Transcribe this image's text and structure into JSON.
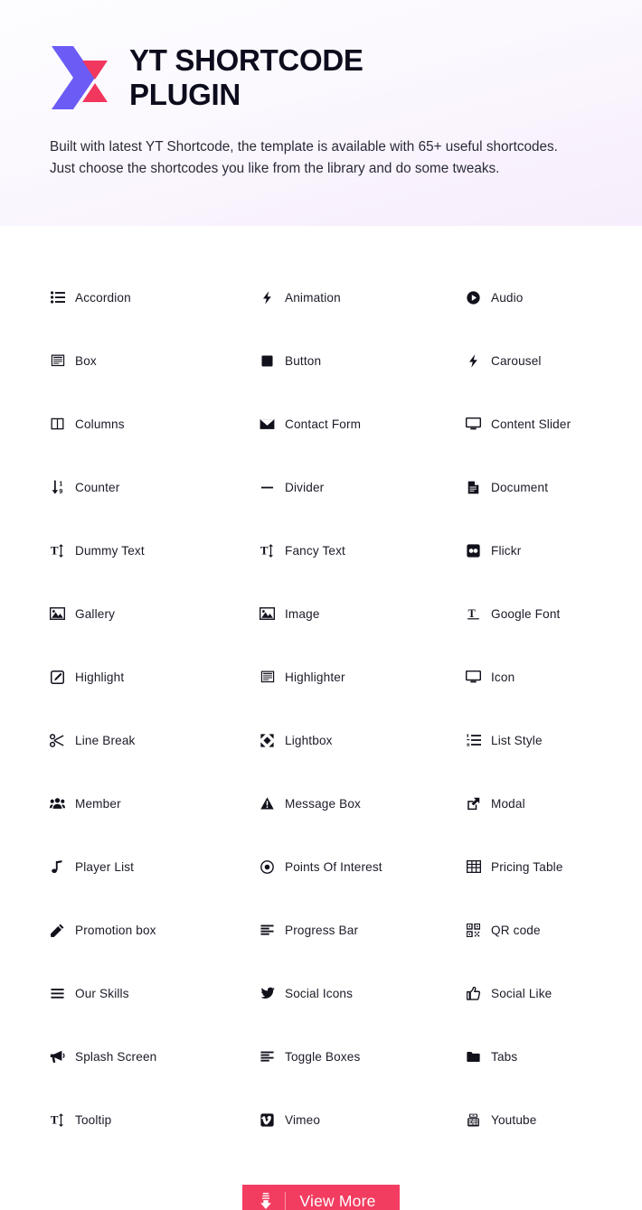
{
  "hero": {
    "logo_icon": "yt-shortcode-logo",
    "logo_colors": {
      "chevron": "#6b5cf6",
      "accent": "#f2375f"
    },
    "title": "YT SHORTCODE PLUGIN",
    "description": "Built with latest YT Shortcode, the template is available with 65+ useful shortcodes. Just choose the shortcodes you like from the library and do some tweaks.",
    "background_from": "#fdfdff",
    "background_to": "#f7edfc"
  },
  "shortcodes": [
    {
      "label": "Accordion",
      "icon": "list-ul-icon"
    },
    {
      "label": "Animation",
      "icon": "bolt-icon"
    },
    {
      "label": "Audio",
      "icon": "play-circle-icon"
    },
    {
      "label": "Box",
      "icon": "window-text-icon"
    },
    {
      "label": "Button",
      "icon": "square-filled-icon"
    },
    {
      "label": "Carousel",
      "icon": "bolt-icon"
    },
    {
      "label": "Columns",
      "icon": "columns-icon"
    },
    {
      "label": "Contact Form",
      "icon": "envelope-icon"
    },
    {
      "label": "Content Slider",
      "icon": "desktop-icon"
    },
    {
      "label": "Counter",
      "icon": "sort-numeric-down-icon"
    },
    {
      "label": "Divider",
      "icon": "minus-icon"
    },
    {
      "label": "Document",
      "icon": "file-lines-icon"
    },
    {
      "label": "Dummy Text",
      "icon": "text-height-icon"
    },
    {
      "label": "Fancy Text",
      "icon": "text-height-icon"
    },
    {
      "label": "Flickr",
      "icon": "flickr-icon"
    },
    {
      "label": "Gallery",
      "icon": "image-icon"
    },
    {
      "label": "Image",
      "icon": "image-icon"
    },
    {
      "label": "Google Font",
      "icon": "text-width-icon"
    },
    {
      "label": "Highlight",
      "icon": "pen-square-icon"
    },
    {
      "label": "Highlighter",
      "icon": "window-text-icon"
    },
    {
      "label": "Icon",
      "icon": "desktop-icon"
    },
    {
      "label": "Line Break",
      "icon": "scissors-icon"
    },
    {
      "label": "Lightbox",
      "icon": "expand-arrows-icon"
    },
    {
      "label": "List Style",
      "icon": "list-ol-icon"
    },
    {
      "label": "Member",
      "icon": "users-icon"
    },
    {
      "label": "Message Box",
      "icon": "exclamation-triangle-icon"
    },
    {
      "label": "Modal",
      "icon": "external-link-icon"
    },
    {
      "label": "Player List",
      "icon": "music-note-icon"
    },
    {
      "label": "Points Of Interest",
      "icon": "dot-circle-icon"
    },
    {
      "label": "Pricing Table",
      "icon": "table-icon"
    },
    {
      "label": "Promotion box",
      "icon": "pencil-icon"
    },
    {
      "label": "Progress Bar",
      "icon": "align-left-bars-icon"
    },
    {
      "label": "QR code",
      "icon": "qrcode-icon"
    },
    {
      "label": "Our Skills",
      "icon": "bars-icon"
    },
    {
      "label": "Social Icons",
      "icon": "twitter-bird-icon"
    },
    {
      "label": "Social Like",
      "icon": "thumbs-up-icon"
    },
    {
      "label": "Splash Screen",
      "icon": "bullhorn-icon"
    },
    {
      "label": "Toggle Boxes",
      "icon": "align-left-bars-icon"
    },
    {
      "label": "Tabs",
      "icon": "folder-icon"
    },
    {
      "label": "Tooltip",
      "icon": "text-height-icon"
    },
    {
      "label": "Vimeo",
      "icon": "vimeo-icon"
    },
    {
      "label": "Youtube",
      "icon": "youtube-icon"
    }
  ],
  "view_more_button": {
    "label": "View More",
    "icon": "download-arrow-icon",
    "background": "#f23d61",
    "text_color": "#ffffff"
  }
}
